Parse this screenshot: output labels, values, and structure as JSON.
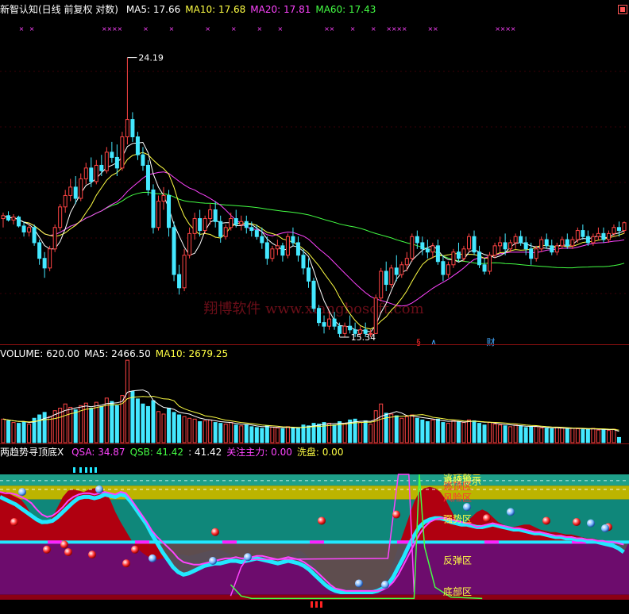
{
  "colors": {
    "up": "#ff4444",
    "down": "#44e8ff",
    "ma5": "#ffffff",
    "ma10": "#ffff44",
    "ma20": "#ff44ff",
    "ma60": "#44ff44",
    "vol_up": "#ff4444",
    "vol_down": "#44e8ff",
    "watermark": "#6a0e18"
  },
  "icons": {
    "menu": "menu-grid-icon"
  },
  "price_panel": {
    "title": "新智认知(日线 前复权 对数)",
    "ma_legend": [
      {
        "label": "MA5: 17.66",
        "color": "#ffffff"
      },
      {
        "label": "MA10: 17.68",
        "color": "#ffff44"
      },
      {
        "label": "MA20: 17.81",
        "color": "#ff44ff"
      },
      {
        "label": "MA60: 17.43",
        "color": "#44ff44"
      }
    ],
    "high_label": "24.19",
    "low_label": "15.34",
    "watermark": "翔博软件 www.xiangbosoft.com",
    "markers": [
      {
        "text": "§",
        "color": "#ff2a2a"
      },
      {
        "text": "∧",
        "color": "#44aaff"
      },
      {
        "text": "财",
        "color": "#44aaff"
      }
    ]
  },
  "volume_panel": {
    "legend": [
      {
        "label": "VOLUME: 620.00",
        "color": "#ffffff"
      },
      {
        "label": "MA5: 2466.50",
        "color": "#ffffff"
      },
      {
        "label": "MA10: 2679.25",
        "color": "#ffff44"
      }
    ]
  },
  "indicator_panel": {
    "title": "两趋势寻顶底X",
    "legend": [
      {
        "label": "QSA: 34.87",
        "color": "#ff44ff"
      },
      {
        "label": "QSB: 41.42",
        "color": "#44ff44"
      },
      {
        "label": ": 41.42",
        "color": "#ffffff"
      },
      {
        "label": "关注主力: 0.00",
        "color": "#ff44ff"
      },
      {
        "label": "洗盘: 0.00",
        "color": "#ffff44"
      }
    ],
    "zone_labels": [
      {
        "text": "逃顶警示",
        "value": 97,
        "color": "#ffff44"
      },
      {
        "text": "风险提示",
        "value": 95,
        "color": "#ffff44"
      },
      {
        "text": "逃顶区",
        "value": 91,
        "color": "#ff3333"
      },
      {
        "text": "风险区",
        "value": 82,
        "color": "#ff3333"
      },
      {
        "text": "强势区",
        "value": 65,
        "color": "#ffff44"
      },
      {
        "text": "反弹区",
        "value": 32,
        "color": "#ffff44"
      },
      {
        "text": "底部区",
        "value": 7,
        "color": "#ffff44"
      }
    ]
  },
  "chart_data": {
    "type": "candlestick",
    "price_axis": {
      "scale": "log",
      "ylim": [
        14.2,
        25.8
      ]
    },
    "candles": [
      [
        17.8,
        18.0,
        17.5,
        17.9
      ],
      [
        17.9,
        18.05,
        17.7,
        17.75
      ],
      [
        17.75,
        17.95,
        17.6,
        17.85
      ],
      [
        17.85,
        17.9,
        17.5,
        17.55
      ],
      [
        17.55,
        17.7,
        17.2,
        17.35
      ],
      [
        17.35,
        17.6,
        17.2,
        17.5
      ],
      [
        17.5,
        17.6,
        16.9,
        17.0
      ],
      [
        17.0,
        17.1,
        16.3,
        16.5
      ],
      [
        16.5,
        16.7,
        15.9,
        16.2
      ],
      [
        16.2,
        16.9,
        16.1,
        16.8
      ],
      [
        16.8,
        17.6,
        16.7,
        17.5
      ],
      [
        17.5,
        18.3,
        17.4,
        18.2
      ],
      [
        18.2,
        18.8,
        18.0,
        18.6
      ],
      [
        18.6,
        19.2,
        18.4,
        18.9
      ],
      [
        18.9,
        19.3,
        18.3,
        18.5
      ],
      [
        18.5,
        19.4,
        18.4,
        19.2
      ],
      [
        19.2,
        19.8,
        19.0,
        19.6
      ],
      [
        19.6,
        20.0,
        18.9,
        19.1
      ],
      [
        19.1,
        19.9,
        19.0,
        19.7
      ],
      [
        19.7,
        20.1,
        19.3,
        19.5
      ],
      [
        19.5,
        20.4,
        19.4,
        20.2
      ],
      [
        20.2,
        20.6,
        19.8,
        20.0
      ],
      [
        20.0,
        20.5,
        19.3,
        19.6
      ],
      [
        19.6,
        21.0,
        19.5,
        20.8
      ],
      [
        20.8,
        24.19,
        20.5,
        21.5
      ],
      [
        21.5,
        21.8,
        20.6,
        20.8
      ],
      [
        20.8,
        21.0,
        19.9,
        20.1
      ],
      [
        20.1,
        20.4,
        19.5,
        19.7
      ],
      [
        19.7,
        19.9,
        18.6,
        18.8
      ],
      [
        18.8,
        19.0,
        17.3,
        17.5
      ],
      [
        17.5,
        18.6,
        17.4,
        18.4
      ],
      [
        18.4,
        18.9,
        18.1,
        18.6
      ],
      [
        18.6,
        18.8,
        17.2,
        17.5
      ],
      [
        17.5,
        17.7,
        15.8,
        16.0
      ],
      [
        16.0,
        16.3,
        15.4,
        15.6
      ],
      [
        15.6,
        16.8,
        15.5,
        16.6
      ],
      [
        16.6,
        17.5,
        16.5,
        17.3
      ],
      [
        17.3,
        18.0,
        17.1,
        17.8
      ],
      [
        17.8,
        18.1,
        17.2,
        17.4
      ],
      [
        17.4,
        17.9,
        17.3,
        17.8
      ],
      [
        17.8,
        18.3,
        17.6,
        18.1
      ],
      [
        18.1,
        18.4,
        17.5,
        17.7
      ],
      [
        17.7,
        17.9,
        17.0,
        17.2
      ],
      [
        17.2,
        17.6,
        17.1,
        17.5
      ],
      [
        17.5,
        18.0,
        17.4,
        17.8
      ],
      [
        17.8,
        18.1,
        17.5,
        17.6
      ],
      [
        17.6,
        17.9,
        17.4,
        17.7
      ],
      [
        17.7,
        17.9,
        17.3,
        17.5
      ],
      [
        17.5,
        17.7,
        17.2,
        17.4
      ],
      [
        17.4,
        17.6,
        17.1,
        17.2
      ],
      [
        17.2,
        17.5,
        16.8,
        17.0
      ],
      [
        17.0,
        17.2,
        16.3,
        16.5
      ],
      [
        16.5,
        16.9,
        16.4,
        16.8
      ],
      [
        16.8,
        17.1,
        16.6,
        16.9
      ],
      [
        16.9,
        17.0,
        16.4,
        16.6
      ],
      [
        16.6,
        17.3,
        16.5,
        17.2
      ],
      [
        17.2,
        17.5,
        16.9,
        17.0
      ],
      [
        17.0,
        17.2,
        16.4,
        16.6
      ],
      [
        16.6,
        16.8,
        16.0,
        16.2
      ],
      [
        16.2,
        16.5,
        15.6,
        15.8
      ],
      [
        15.8,
        15.9,
        14.9,
        15.0
      ],
      [
        15.0,
        15.1,
        14.5,
        14.6
      ],
      [
        14.6,
        14.8,
        14.3,
        14.5
      ],
      [
        14.5,
        14.9,
        14.4,
        14.7
      ],
      [
        14.7,
        14.9,
        14.4,
        14.5
      ],
      [
        14.5,
        14.6,
        14.2,
        14.3
      ],
      [
        14.3,
        14.6,
        14.2,
        14.5
      ],
      [
        14.5,
        14.8,
        14.3,
        14.4
      ],
      [
        14.4,
        14.6,
        14.2,
        14.3
      ],
      [
        14.3,
        14.5,
        14.2,
        14.4
      ],
      [
        14.4,
        14.6,
        14.2,
        14.3
      ],
      [
        14.3,
        14.4,
        14.2,
        14.3
      ],
      [
        14.3,
        15.4,
        14.3,
        15.3
      ],
      [
        15.3,
        16.2,
        15.2,
        16.1
      ],
      [
        16.1,
        16.4,
        15.5,
        15.7
      ],
      [
        15.7,
        16.3,
        15.6,
        16.2
      ],
      [
        16.2,
        16.6,
        15.8,
        16.0
      ],
      [
        16.0,
        16.4,
        15.9,
        16.3
      ],
      [
        16.3,
        16.7,
        16.1,
        16.5
      ],
      [
        16.5,
        17.3,
        16.4,
        17.2
      ],
      [
        17.2,
        17.4,
        16.8,
        17.0
      ],
      [
        17.0,
        17.2,
        16.6,
        16.8
      ],
      [
        16.8,
        17.1,
        16.5,
        16.7
      ],
      [
        16.7,
        17.0,
        16.5,
        16.9
      ],
      [
        16.9,
        17.1,
        16.3,
        16.4
      ],
      [
        16.4,
        16.6,
        15.8,
        16.0
      ],
      [
        16.0,
        16.4,
        15.9,
        16.3
      ],
      [
        16.3,
        16.8,
        16.2,
        16.7
      ],
      [
        16.7,
        17.0,
        16.4,
        16.5
      ],
      [
        16.5,
        16.9,
        16.4,
        16.8
      ],
      [
        16.8,
        17.3,
        16.7,
        17.2
      ],
      [
        17.2,
        17.4,
        16.6,
        16.7
      ],
      [
        16.7,
        16.9,
        16.2,
        16.3
      ],
      [
        16.3,
        16.5,
        16.0,
        16.1
      ],
      [
        16.1,
        16.7,
        16.0,
        16.6
      ],
      [
        16.6,
        17.0,
        16.5,
        16.9
      ],
      [
        16.9,
        17.2,
        16.7,
        17.0
      ],
      [
        17.0,
        17.3,
        16.6,
        16.8
      ],
      [
        16.8,
        17.1,
        16.7,
        17.0
      ],
      [
        17.0,
        17.3,
        16.8,
        17.2
      ],
      [
        17.2,
        17.4,
        16.9,
        17.0
      ],
      [
        17.0,
        17.2,
        16.6,
        16.8
      ],
      [
        16.8,
        17.0,
        16.3,
        16.5
      ],
      [
        16.5,
        16.9,
        16.4,
        16.8
      ],
      [
        16.8,
        17.2,
        16.7,
        17.1
      ],
      [
        17.1,
        17.3,
        16.8,
        16.9
      ],
      [
        16.9,
        17.1,
        16.6,
        16.7
      ],
      [
        16.7,
        17.0,
        16.6,
        16.9
      ],
      [
        16.9,
        17.2,
        16.8,
        17.1
      ],
      [
        17.1,
        17.3,
        16.8,
        16.9
      ],
      [
        16.9,
        17.2,
        16.8,
        17.1
      ],
      [
        17.1,
        17.5,
        17.0,
        17.4
      ],
      [
        17.4,
        17.6,
        17.1,
        17.2
      ],
      [
        17.2,
        17.4,
        16.9,
        17.0
      ],
      [
        17.0,
        17.3,
        16.9,
        17.2
      ],
      [
        17.2,
        17.5,
        17.1,
        17.3
      ],
      [
        17.3,
        17.5,
        17.0,
        17.1
      ],
      [
        17.1,
        17.4,
        17.0,
        17.3
      ],
      [
        17.3,
        17.6,
        17.2,
        17.5
      ],
      [
        17.5,
        17.7,
        17.2,
        17.4
      ],
      [
        17.4,
        17.7,
        17.3,
        17.66
      ]
    ],
    "volume_axis": {
      "ylim": [
        0,
        10000
      ]
    },
    "volume": [
      2800,
      2600,
      2400,
      2300,
      2500,
      2200,
      2900,
      3300,
      3600,
      3100,
      3800,
      4100,
      4600,
      4200,
      3900,
      4400,
      4700,
      4100,
      4800,
      4300,
      5300,
      4900,
      4400,
      5600,
      9800,
      6100,
      5200,
      4600,
      4300,
      5000,
      3700,
      3400,
      4100,
      3600,
      3300,
      3100,
      2900,
      2800,
      2500,
      2600,
      2700,
      2400,
      2300,
      2200,
      2400,
      2100,
      2000,
      2150,
      1900,
      1800,
      1700,
      2000,
      1850,
      1750,
      1650,
      1900,
      1700,
      1800,
      2100,
      2000,
      2300,
      2200,
      2400,
      2300,
      2100,
      2500,
      2300,
      2700,
      2800,
      2400,
      2600,
      2200,
      3800,
      4600,
      3500,
      3400,
      3200,
      2900,
      3100,
      3300,
      2900,
      2700,
      2500,
      2700,
      2800,
      2400,
      2300,
      2600,
      2500,
      2400,
      2700,
      2600,
      2300,
      2100,
      2400,
      2200,
      2100,
      2000,
      1900,
      2100,
      2000,
      1800,
      1850,
      1900,
      1750,
      1700,
      1650,
      1800,
      1750,
      1600,
      1700,
      1650,
      1550,
      1600,
      1700,
      1500,
      1550,
      1450,
      1600,
      620
    ],
    "indicator_axis": {
      "ylim": [
        0,
        100
      ]
    },
    "zones": [
      {
        "from": 91,
        "to": 100,
        "color": "#1ea08a"
      },
      {
        "from": 80,
        "to": 91,
        "color": "#bcb400"
      },
      {
        "from": 46,
        "to": 80,
        "color": "#0f877a"
      },
      {
        "from": 4,
        "to": 46,
        "color": "#6d0c6d"
      },
      {
        "from": 0,
        "to": 4,
        "color": "#8c0014"
      }
    ],
    "dashed_levels": [
      95,
      88
    ],
    "mid_band": 46,
    "qsa": [
      86,
      85,
      85,
      84,
      82,
      80,
      77,
      72,
      68,
      66,
      67,
      70,
      74,
      79,
      82,
      84,
      85,
      85,
      84,
      85,
      86,
      85,
      84,
      86,
      85,
      80,
      74,
      68,
      62,
      55,
      50,
      46,
      42,
      38,
      33,
      30,
      29,
      28,
      28,
      29,
      30,
      31,
      32,
      33,
      33,
      34,
      33,
      33,
      34,
      35,
      35,
      34,
      33,
      32,
      33,
      34,
      33,
      32,
      30,
      27,
      24,
      20,
      16,
      12,
      9,
      8,
      7,
      7,
      7,
      7,
      7,
      7,
      7,
      8,
      10,
      14,
      20,
      28,
      36,
      44,
      52,
      58,
      62,
      64,
      65,
      65,
      64,
      63,
      62,
      61,
      60,
      58,
      59,
      60,
      61,
      60,
      59,
      58,
      57,
      57,
      56,
      55,
      54,
      54,
      53,
      52,
      51,
      51,
      50,
      50,
      49,
      49,
      48,
      48,
      47,
      47,
      46,
      46,
      45,
      44
    ],
    "qsb": [
      82,
      80,
      78,
      76,
      73,
      70,
      67,
      64,
      62,
      62,
      63,
      66,
      70,
      74,
      78,
      81,
      82,
      82,
      81,
      82,
      84,
      83,
      82,
      84,
      83,
      78,
      72,
      66,
      60,
      52,
      45,
      38,
      32,
      26,
      22,
      20,
      21,
      23,
      25,
      27,
      28,
      29,
      29,
      30,
      31,
      31,
      30,
      31,
      32,
      33,
      32,
      31,
      30,
      29,
      30,
      31,
      30,
      29,
      27,
      24,
      20,
      16,
      12,
      9,
      7,
      6,
      6,
      6,
      6,
      6,
      6,
      6,
      7,
      9,
      12,
      18,
      26,
      34,
      43,
      51,
      58,
      62,
      64,
      65,
      65,
      64,
      62,
      61,
      60,
      60,
      59,
      58,
      58,
      59,
      60,
      59,
      58,
      57,
      56,
      56,
      55,
      54,
      53,
      53,
      52,
      51,
      50,
      50,
      49,
      49,
      48,
      48,
      47,
      47,
      46,
      45,
      44,
      43,
      41,
      38
    ],
    "red_area": [
      86,
      86,
      84,
      82,
      80,
      75,
      68,
      62,
      60,
      61,
      66,
      74,
      82,
      87,
      88,
      87,
      86,
      88,
      89,
      89,
      86,
      80,
      70,
      62,
      55,
      48,
      42,
      38,
      35,
      33,
      32,
      33,
      34,
      35,
      36,
      36,
      35,
      36,
      37,
      38,
      39,
      40,
      40,
      38,
      36,
      34,
      33,
      33,
      34,
      35,
      35,
      34,
      33,
      32,
      33,
      36,
      38,
      40,
      37,
      33,
      28,
      22,
      16,
      11,
      9,
      9,
      9,
      9,
      9,
      9,
      9,
      9,
      10,
      14,
      20,
      30,
      42,
      54,
      66,
      78,
      86,
      89,
      90,
      89,
      86,
      80,
      72,
      64,
      60,
      62,
      66,
      70,
      72,
      70,
      66,
      62,
      60,
      58,
      58,
      59,
      60,
      60,
      58,
      56,
      55,
      54,
      54,
      53,
      52,
      52,
      51,
      50,
      49,
      49,
      48,
      47,
      47,
      46,
      46,
      45
    ],
    "qsa_spike": [
      [
        44,
        3
      ],
      [
        46,
        26
      ],
      [
        47,
        32
      ],
      [
        74,
        33
      ],
      [
        76,
        100
      ],
      [
        78,
        100
      ],
      [
        79,
        6
      ]
    ],
    "qsb_spike": [
      [
        44,
        12
      ],
      [
        46,
        3
      ],
      [
        48,
        1
      ],
      [
        79,
        1
      ],
      [
        80,
        100
      ],
      [
        81,
        42
      ],
      [
        83,
        10
      ],
      [
        86,
        2
      ],
      [
        92,
        1
      ]
    ],
    "red_balls": [
      [
        18,
        62
      ],
      [
        59,
        40
      ],
      [
        81,
        44
      ],
      [
        86,
        38
      ],
      [
        116,
        36
      ],
      [
        159,
        29
      ],
      [
        170,
        40
      ],
      [
        271,
        54
      ],
      [
        405,
        63
      ],
      [
        499,
        68
      ],
      [
        613,
        65
      ],
      [
        688,
        63
      ],
      [
        726,
        62
      ],
      [
        766,
        58
      ]
    ],
    "blue_balls": [
      [
        28,
        86
      ],
      [
        125,
        88
      ],
      [
        192,
        33
      ],
      [
        268,
        31
      ],
      [
        312,
        34
      ],
      [
        452,
        13
      ],
      [
        485,
        12
      ],
      [
        588,
        74
      ],
      [
        643,
        70
      ],
      [
        744,
        61
      ],
      [
        762,
        57
      ]
    ],
    "cyan_ticks": [
      92,
      100,
      107,
      113,
      119
    ],
    "red_ticks": [
      391,
      397,
      403
    ]
  }
}
